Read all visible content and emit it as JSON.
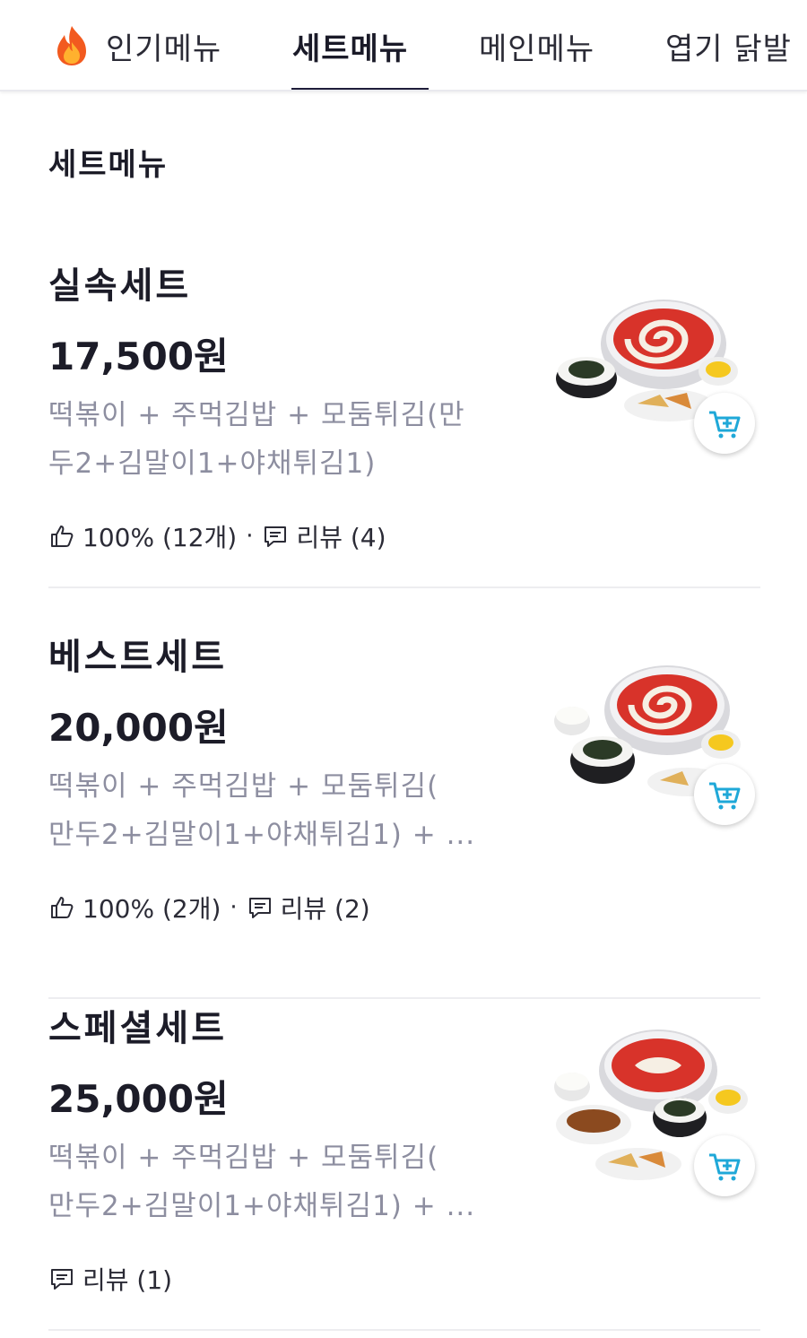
{
  "tabs": [
    {
      "label": "인기메뉴",
      "icon": "fire-icon"
    },
    {
      "label": "세트메뉴",
      "active": true
    },
    {
      "label": "메인메뉴"
    },
    {
      "label": "엽기 닭발"
    }
  ],
  "section": {
    "title": "세트메뉴"
  },
  "items": [
    {
      "name": "실속세트",
      "price": "17,500원",
      "desc_line1": "떡볶이 + 주먹김밥 + 모둠튀김(만",
      "desc_line2": "두2+김말이1+야채튀김1)",
      "like_text": "100% (12개)",
      "review_text": "리뷰 (4)"
    },
    {
      "name": "베스트세트",
      "price": "20,000원",
      "desc_line1": "떡볶이 + 주먹김밥 + 모둠튀김(",
      "desc_line2": "만두2+김말이1+야채튀김1) + ...",
      "like_text": "100% (2개)",
      "review_text": "리뷰 (2)"
    },
    {
      "name": "스페셜세트",
      "price": "25,000원",
      "desc_line1": "떡볶이 + 주먹김밥 + 모둠튀김(",
      "desc_line2": "만두2+김말이1+야채튀김1) + ...",
      "review_text": "리뷰 (1)"
    }
  ],
  "colors": {
    "active_tab_underline": "#1f1d3a",
    "desc_text": "#8d8ea0",
    "cart_icon": "#1fa8d8",
    "sauce": "#d8332a"
  }
}
